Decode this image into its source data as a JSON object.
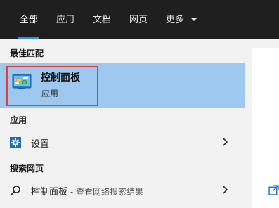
{
  "tabs": [
    {
      "label": "全部",
      "active": true
    },
    {
      "label": "应用",
      "active": false
    },
    {
      "label": "文档",
      "active": false
    },
    {
      "label": "网页",
      "active": false
    },
    {
      "label": "更多",
      "active": false,
      "dropdown": true
    }
  ],
  "sections": {
    "best_match": "最佳匹配",
    "apps": "应用",
    "web": "搜索网页"
  },
  "best_match": {
    "title": "控制面板",
    "subtitle": "应用",
    "icon": "control-panel-icon"
  },
  "apps": [
    {
      "label": "设置",
      "icon": "gear-icon"
    }
  ],
  "web": [
    {
      "query": "控制面板",
      "suffix": " - 查看网络搜索结果",
      "icon": "search-icon"
    }
  ],
  "colors": {
    "tabbar_bg": "#1f1f1f",
    "accent": "#2f8fde",
    "selected_bg": "#9ec8ef",
    "highlight_box": "#e0403a"
  }
}
